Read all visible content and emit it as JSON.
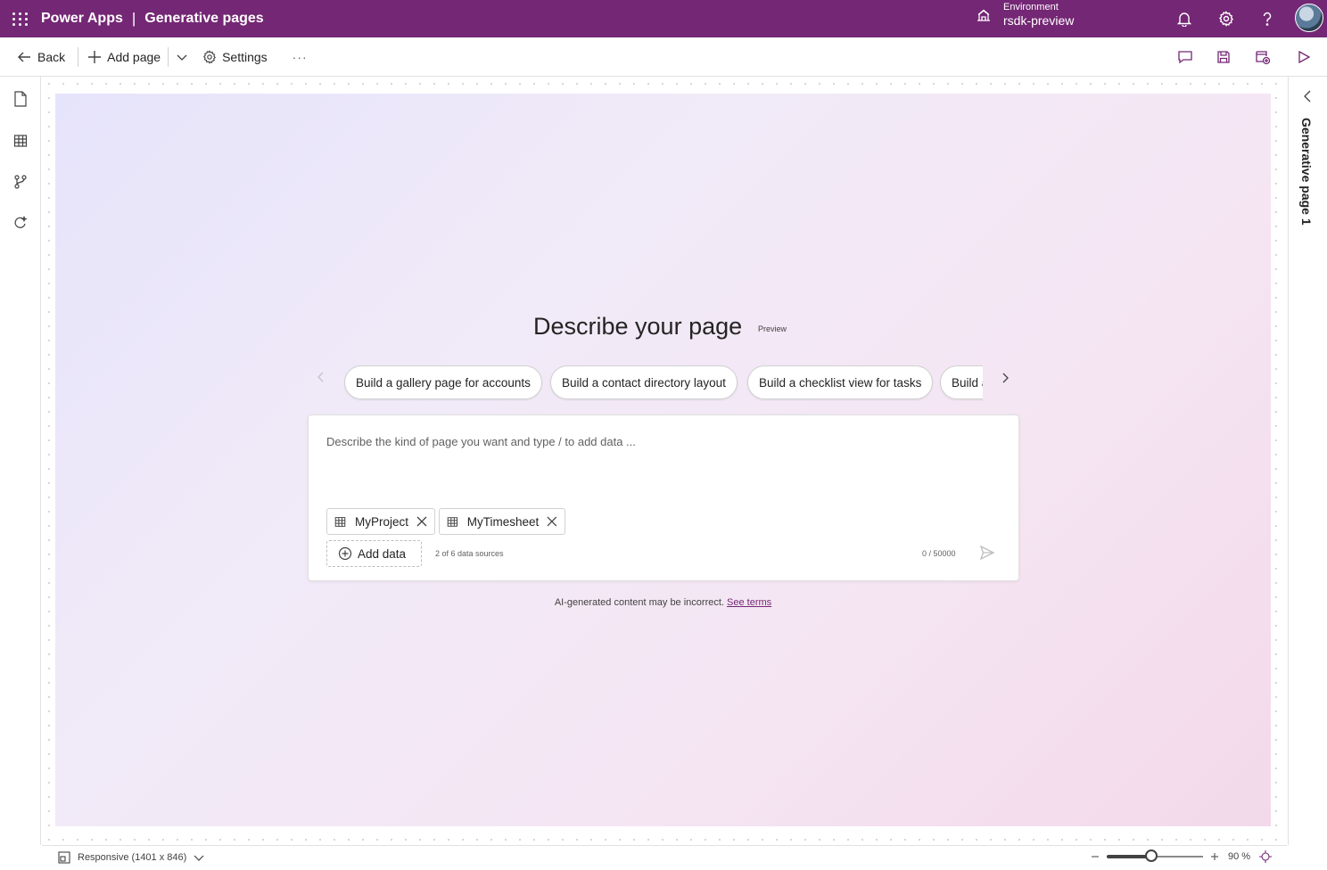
{
  "app": {
    "name": "Power Apps",
    "separator": "|",
    "section": "Generative pages"
  },
  "environment": {
    "label": "Environment",
    "name": "rsdk-preview"
  },
  "commands": {
    "back": "Back",
    "add_page": "Add page",
    "settings": "Settings",
    "more": "···"
  },
  "canvas": {
    "headline": "Describe your page",
    "badge": "Preview",
    "suggestions": [
      "Build a gallery page for accounts",
      "Build a contact directory layout",
      "Build a checklist view for tasks",
      "Build a"
    ],
    "prompt": {
      "placeholder": "Describe the kind of page you want and type / to add data ...",
      "data_sources": [
        "MyProject",
        "MyTimesheet"
      ],
      "add_data": "Add data",
      "source_count": "2 of 6 data sources",
      "char_count": "0 / 50000"
    },
    "disclaimer": "AI-generated content may be incorrect.",
    "terms_link": "See terms"
  },
  "right_panel": {
    "title": "Generative page 1"
  },
  "status": {
    "layout": "Responsive (1401 x 846)",
    "zoom_value": 0.9,
    "zoom_label": "90 %"
  },
  "colors": {
    "brand": "#742774",
    "link": "#742774"
  }
}
